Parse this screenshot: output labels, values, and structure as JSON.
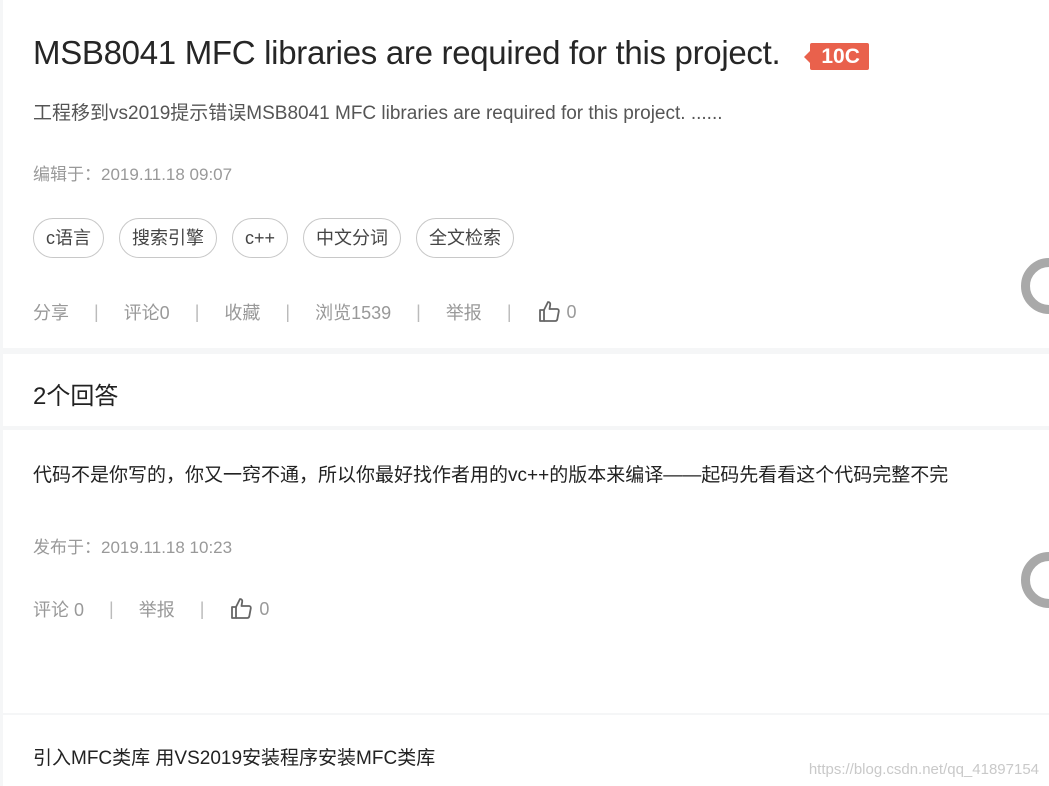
{
  "question": {
    "title": "MSB8041 MFC libraries are required for this project.",
    "reward": "10C",
    "description": "工程移到vs2019提示错误MSB8041 MFC libraries are required for this project. ......",
    "edited": "编辑于：2019.11.18 09:07",
    "tags": [
      "c语言",
      "搜索引擎",
      "c++",
      "中文分词",
      "全文检索"
    ],
    "actions": {
      "share": "分享",
      "comment": "评论0",
      "favorite": "收藏",
      "views": "浏览1539",
      "report": "举报",
      "likes": "0"
    }
  },
  "answers_header": "2个回答",
  "answers": [
    {
      "text": "代码不是你写的，你又一窍不通，所以你最好找作者用的vc++的版本来编译——起码先看看这个代码完整不完",
      "published": "发布于：2019.11.18 10:23",
      "comment": "评论 0",
      "report": "举报",
      "likes": "0"
    },
    {
      "text": "引入MFC类库 用VS2019安装程序安装MFC类库"
    }
  ],
  "watermark": "https://blog.csdn.net/qq_41897154",
  "colors": {
    "reward_bg": "#e9614c",
    "meta_text": "#999999",
    "background": "#f5f6f7"
  },
  "icons": {
    "like": "thumbs-up-icon"
  }
}
